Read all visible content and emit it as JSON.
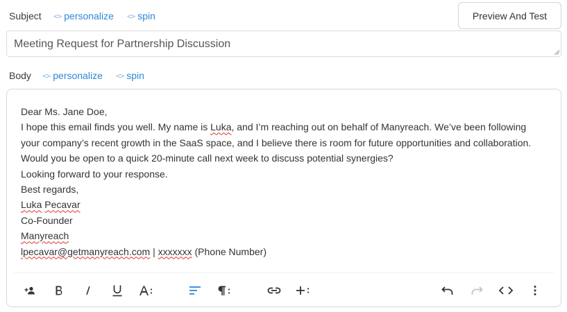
{
  "subject": {
    "label": "Subject",
    "personalize": "personalize",
    "spin": "spin",
    "value": "Meeting Request for Partnership Discussion"
  },
  "preview_button": "Preview And Test",
  "body": {
    "label": "Body",
    "personalize": "personalize",
    "spin": "spin",
    "lines": {
      "greeting": "Dear Ms. Jane Doe,",
      "l1a": "I hope this email finds you well. My name is ",
      "l1name": "Luka",
      "l1b": ", and I’m reaching out on behalf of Manyreach. We’ve been following",
      "l2": "your company’s recent growth in the SaaS space, and I believe there is room for future opportunities and collaboration.",
      "l3": "Would you be open to a quick 20-minute call next week to discuss potential synergies?",
      "l4": "Looking forward to your response.",
      "l5": "Best regards,",
      "first": "Luka",
      "last": "Pecavar",
      "title": "Co-Founder",
      "company": "Manyreach",
      "email": "lpecavar@getmanyreach.com",
      "sep": " | ",
      "phone": "xxxxxxx",
      "phone_note": " (Phone Number)"
    }
  },
  "toolbar": {
    "icons": [
      "add-contact-icon",
      "bold-icon",
      "italic-icon",
      "underline-icon",
      "font-size-icon",
      "align-left-icon",
      "paragraph-icon",
      "link-icon",
      "insert-icon",
      "undo-icon",
      "redo-icon",
      "code-icon",
      "more-icon"
    ],
    "active_color": "#2f86d6"
  }
}
